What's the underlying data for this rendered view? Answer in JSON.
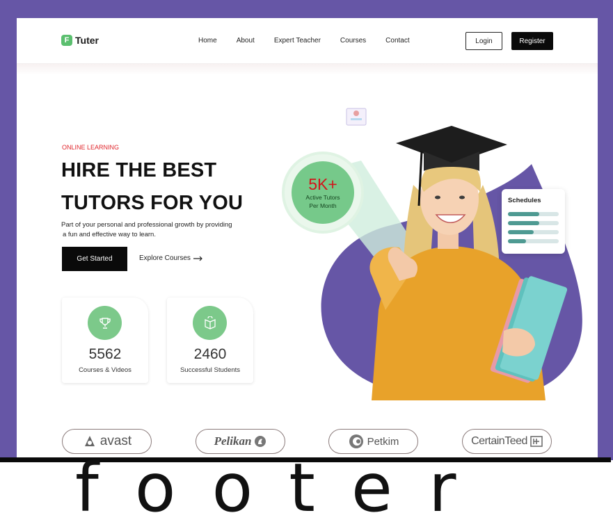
{
  "brand": {
    "logo_letter": "F",
    "name": "Tuter"
  },
  "nav": {
    "items": [
      "Home",
      "About",
      "Expert Teacher",
      "Courses",
      "Contact"
    ],
    "login_label": "Login",
    "register_label": "Register"
  },
  "hero": {
    "eyebrow": "ONLINE LEARNING",
    "title_line1": "HIRE THE BEST",
    "title_line2": "TUTORS FOR YOU",
    "description_line1": "Part of your personal and professional growth by providing",
    "description_line2": "a fun and effective way to learn.",
    "cta_primary": "Get Started",
    "cta_secondary": "Explore Courses",
    "cta_secondary_icon": "arrow-right-icon"
  },
  "stats": [
    {
      "icon": "trophy-icon",
      "value": "5562",
      "label": "Courses & Videos"
    },
    {
      "icon": "open-book-icon",
      "value": "2460",
      "label": "Successful Students"
    }
  ],
  "badge": {
    "value": "5K+",
    "line1": "Active Tutors",
    "line2": "Per Month"
  },
  "schedules": {
    "title": "Schedules",
    "progress": [
      0.62,
      0.62,
      0.5,
      0.35
    ]
  },
  "partners": [
    "avast",
    "Pelikan",
    "Petkim",
    "CertainTeed"
  ],
  "footer": {
    "text": "footer"
  },
  "colors": {
    "frame": "#6656a6",
    "accent_green": "#76c98a",
    "accent_red": "#e0252b",
    "dark": "#0a0a0a",
    "sweater": "#e8a22a"
  }
}
